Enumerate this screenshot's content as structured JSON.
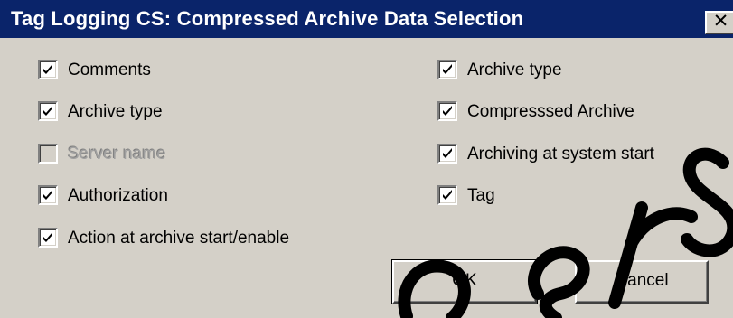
{
  "dialog": {
    "title": "Tag Logging CS: Compressed Archive Data Selection",
    "close_glyph": "✕"
  },
  "left_options": [
    {
      "label": "Comments",
      "checked": true,
      "enabled": true
    },
    {
      "label": "Archive type",
      "checked": true,
      "enabled": true
    },
    {
      "label": "Server name",
      "checked": false,
      "enabled": false
    },
    {
      "label": "Authorization",
      "checked": true,
      "enabled": true
    },
    {
      "label": "Action at archive start/enable",
      "checked": true,
      "enabled": true
    }
  ],
  "right_options": [
    {
      "label": "Archive type",
      "checked": true,
      "enabled": true
    },
    {
      "label": "Compresssed Archive",
      "checked": true,
      "enabled": true
    },
    {
      "label": "Archiving at system start",
      "checked": true,
      "enabled": true
    },
    {
      "label": "Tag",
      "checked": true,
      "enabled": true
    }
  ],
  "buttons": {
    "ok_label": "OK",
    "cancel_label": "Cancel"
  },
  "colors": {
    "title_bar": "#0a246a",
    "dialog_face": "#d4d0c8",
    "watermark": "#000000"
  }
}
